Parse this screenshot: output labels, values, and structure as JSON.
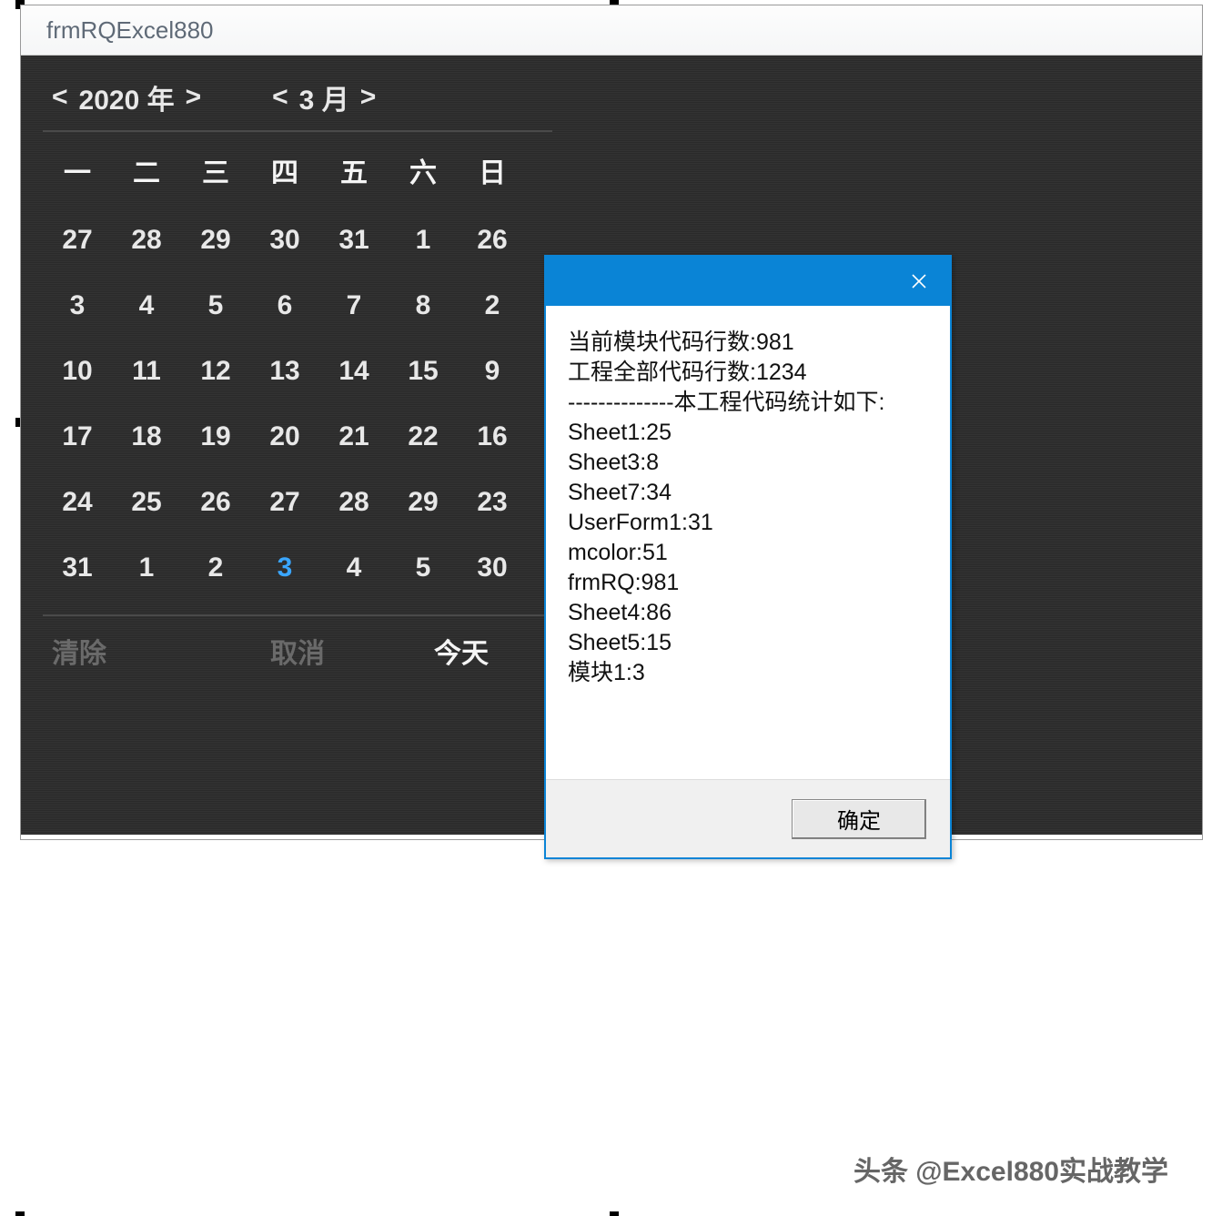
{
  "form": {
    "title": "frmRQExcel880"
  },
  "calendar": {
    "year_label": "2020 年",
    "month_label": "3  月",
    "prev": "<",
    "next": ">",
    "weekdays": [
      "一",
      "二",
      "三",
      "四",
      "五",
      "六",
      "日"
    ],
    "grid": [
      [
        "27",
        "28",
        "29",
        "30",
        "31",
        "1",
        "26"
      ],
      [
        "3",
        "4",
        "5",
        "6",
        "7",
        "8",
        "2"
      ],
      [
        "10",
        "11",
        "12",
        "13",
        "14",
        "15",
        "9"
      ],
      [
        "17",
        "18",
        "19",
        "20",
        "21",
        "22",
        "16"
      ],
      [
        "24",
        "25",
        "26",
        "27",
        "28",
        "29",
        "23"
      ],
      [
        "31",
        "1",
        "2",
        "3",
        "4",
        "5",
        "30"
      ]
    ],
    "today_row": 5,
    "today_col": 3,
    "footer": {
      "clear": "清除",
      "cancel": "取消",
      "today": "今天"
    }
  },
  "msgbox": {
    "lines": [
      "当前模块代码行数:981",
      "工程全部代码行数:1234",
      "--------------本工程代码统计如下:",
      "Sheet1:25",
      "Sheet3:8",
      "Sheet7:34",
      "UserForm1:31",
      "mcolor:51",
      "frmRQ:981",
      "Sheet4:86",
      "Sheet5:15",
      "模块1:3"
    ],
    "ok": "确定"
  },
  "watermark": "头条 @Excel880实战教学"
}
